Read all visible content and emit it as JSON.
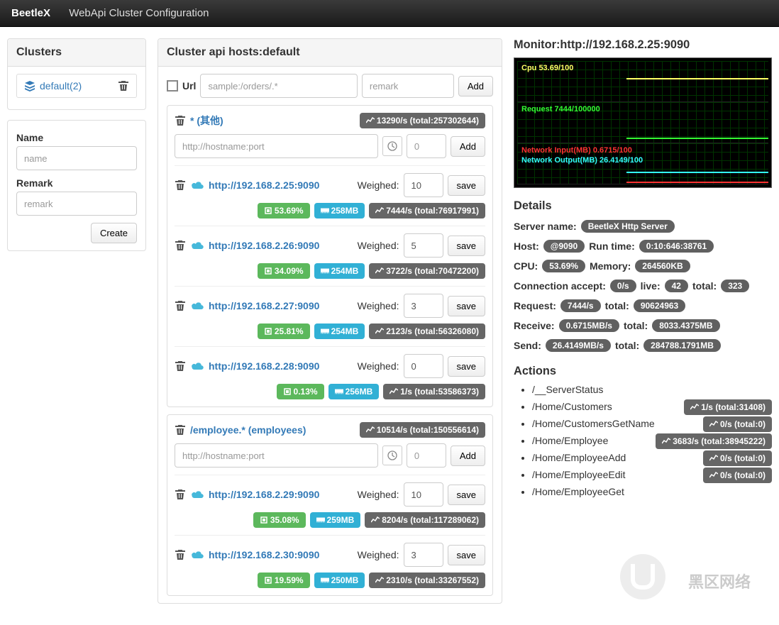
{
  "nav": {
    "brand": "BeetleX",
    "subtitle": "WebApi Cluster Configuration"
  },
  "clusters": {
    "heading": "Clusters",
    "items": [
      {
        "label": "default(2)"
      }
    ],
    "name_label": "Name",
    "name_placeholder": "name",
    "remark_label": "Remark",
    "remark_placeholder": "remark",
    "create_btn": "Create"
  },
  "hosts_panel": {
    "heading": "Cluster api hosts:default",
    "url_label": "Url",
    "url_placeholder": "sample:/orders/.*",
    "remark_placeholder": "remark",
    "add_btn": "Add",
    "host_add_placeholder": "http://hostname:port",
    "weight_placeholder": "0",
    "weighed_label": "Weighed:",
    "save_btn": "save",
    "groups": [
      {
        "title": "* (其他)",
        "stats": "13290/s (total:257302644)",
        "hosts": [
          {
            "url": "http://192.168.2.25:9090",
            "weight": "10",
            "cpu": "53.69%",
            "mem": "258MB",
            "traffic": "7444/s (total:76917991)"
          },
          {
            "url": "http://192.168.2.26:9090",
            "weight": "5",
            "cpu": "34.09%",
            "mem": "254MB",
            "traffic": "3722/s (total:70472200)"
          },
          {
            "url": "http://192.168.2.27:9090",
            "weight": "3",
            "cpu": "25.81%",
            "mem": "254MB",
            "traffic": "2123/s (total:56326080)"
          },
          {
            "url": "http://192.168.2.28:9090",
            "weight": "0",
            "cpu": "0.13%",
            "mem": "256MB",
            "traffic": "1/s (total:53586373)"
          }
        ]
      },
      {
        "title": "/employee.* (employees)",
        "stats": "10514/s (total:150556614)",
        "hosts": [
          {
            "url": "http://192.168.2.29:9090",
            "weight": "10",
            "cpu": "35.08%",
            "mem": "259MB",
            "traffic": "8204/s (total:117289062)"
          },
          {
            "url": "http://192.168.2.30:9090",
            "weight": "3",
            "cpu": "19.59%",
            "mem": "250MB",
            "traffic": "2310/s (total:33267552)"
          }
        ]
      }
    ]
  },
  "monitor": {
    "heading": "Monitor:http://192.168.2.25:9090",
    "cpu": "Cpu 53.69/100",
    "request": "Request 7444/100000",
    "net_in": "Network Input(MB) 0.6715/100",
    "net_out": "Network Output(MB) 26.4149/100"
  },
  "details": {
    "heading": "Details",
    "server_name_label": "Server name:",
    "server_name": "BeetleX Http Server",
    "host_label": "Host:",
    "host": "@9090",
    "runtime_label": "Run time:",
    "runtime": "0:10:646:38761",
    "cpu_label": "CPU:",
    "cpu": "53.69%",
    "memory_label": "Memory:",
    "memory": "264560KB",
    "conn_label": "Connection accept:",
    "conn_rate": "0/s",
    "live_label": "live:",
    "live": "42",
    "total_label": "total:",
    "conn_total": "323",
    "request_label": "Request:",
    "request_rate": "7444/s",
    "request_total": "90624963",
    "receive_label": "Receive:",
    "receive_rate": "0.6715MB/s",
    "receive_total": "8033.4375MB",
    "send_label": "Send:",
    "send_rate": "26.4149MB/s",
    "send_total": "284788.1791MB"
  },
  "actions": {
    "heading": "Actions",
    "items": [
      {
        "path": "/__ServerStatus",
        "stats": ""
      },
      {
        "path": "/Home/Customers",
        "stats": "1/s (total:31408)"
      },
      {
        "path": "/Home/CustomersGetName",
        "stats": "0/s (total:0)"
      },
      {
        "path": "/Home/Employee",
        "stats": "3683/s (total:38945222)"
      },
      {
        "path": "/Home/EmployeeAdd",
        "stats": "0/s (total:0)"
      },
      {
        "path": "/Home/EmployeeEdit",
        "stats": "0/s (total:0)"
      },
      {
        "path": "/Home/EmployeeGet",
        "stats": ""
      }
    ]
  },
  "watermark": "黑区网络"
}
